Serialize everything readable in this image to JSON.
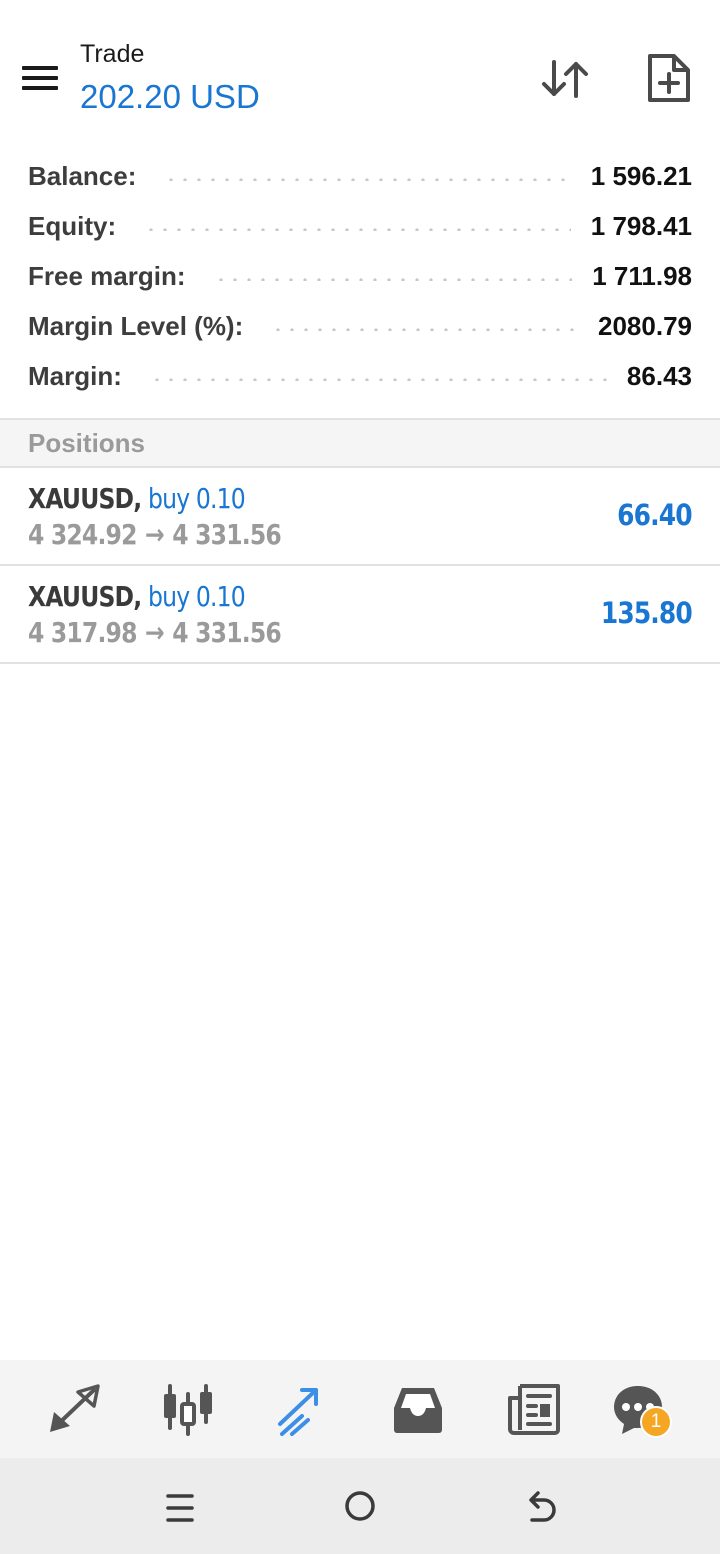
{
  "header": {
    "title": "Trade",
    "subtitle": "202.20 USD",
    "menu_icon": "hamburger-menu-icon",
    "sort_icon": "sort-arrows-icon",
    "new_order_icon": "new-document-icon"
  },
  "summary": [
    {
      "label": "Balance:",
      "value": "1 596.21"
    },
    {
      "label": "Equity:",
      "value": "1 798.41"
    },
    {
      "label": "Free margin:",
      "value": "1 711.98"
    },
    {
      "label": "Margin Level (%):",
      "value": "2080.79"
    },
    {
      "label": "Margin:",
      "value": "86.43"
    }
  ],
  "positions": {
    "title": "Positions",
    "items": [
      {
        "symbol": "XAUUSD",
        "type": "buy 0.10",
        "open_price": "4 324.92",
        "arrow": "→",
        "current_price": "4 331.56",
        "profit": "66.40"
      },
      {
        "symbol": "XAUUSD",
        "type": "buy 0.10",
        "open_price": "4 317.98",
        "arrow": "→",
        "current_price": "4 331.56",
        "profit": "135.80"
      }
    ]
  },
  "bottom_nav": {
    "items": [
      {
        "icon": "quotes-arrows-icon",
        "active": false
      },
      {
        "icon": "candlestick-chart-icon",
        "active": false
      },
      {
        "icon": "trade-icon",
        "active": true
      },
      {
        "icon": "history-inbox-icon",
        "active": false
      },
      {
        "icon": "news-icon",
        "active": false
      },
      {
        "icon": "chat-icon",
        "active": false
      }
    ],
    "chat_badge": "1"
  },
  "system_nav": {
    "items": [
      "recent-apps-icon",
      "home-icon",
      "back-icon"
    ]
  },
  "colors": {
    "accent": "#1976d2",
    "badge": "#f5a623",
    "icon": "#555555",
    "muted_text": "#9a9a9a"
  }
}
